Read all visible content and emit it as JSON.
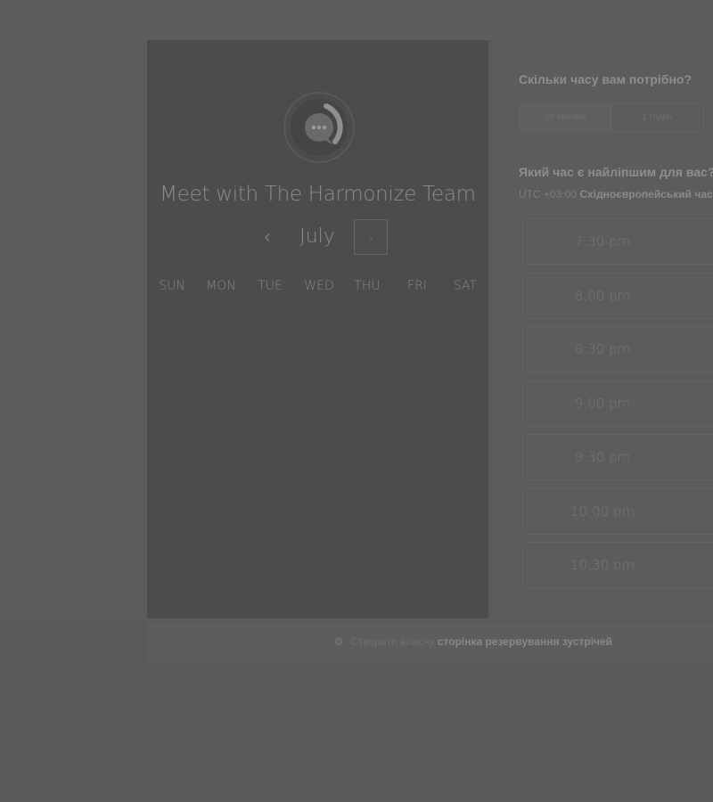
{
  "calendar": {
    "title": "Meet with The Harmonize Team",
    "month": "July",
    "prev_icon": "‹",
    "next_icon": "›",
    "weekdays": [
      "SUN",
      "MON",
      "TUE",
      "WED",
      "THU",
      "FRI",
      "SAT"
    ]
  },
  "booking": {
    "duration_question": "Скільки часу вам потрібно?",
    "durations": [
      "30 хвилин",
      "1 годин"
    ],
    "selected_duration": "30 хвилин",
    "time_question": "Який час є найліпшим для вас?",
    "timezone_prefix": "UTC +03:00",
    "timezone_name": "Східноєвропейський час",
    "slots": [
      "7:30 pm",
      "8:00 pm",
      "8:30 pm",
      "9:00 pm",
      "9:30 pm",
      "10:00 pm",
      "10:30 pm"
    ]
  },
  "footer": {
    "prefix": "Створити власну",
    "link": "сторінка резервування зустрічей"
  },
  "icons": {
    "avatar": "chat-bubble-icon",
    "footer": "hubspot-sprocket-icon"
  }
}
